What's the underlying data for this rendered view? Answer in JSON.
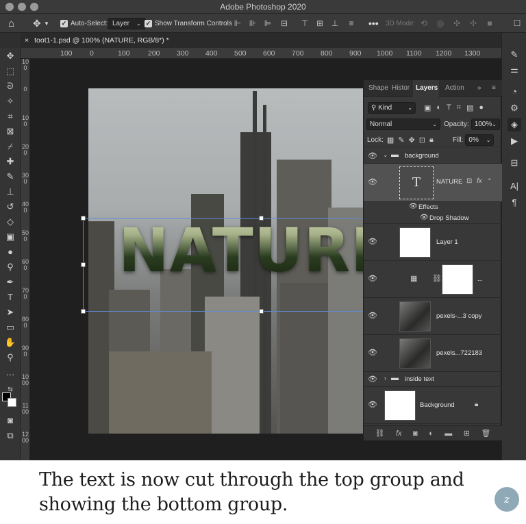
{
  "window": {
    "title": "Adobe Photoshop 2020"
  },
  "options_bar": {
    "auto_select_label": "Auto-Select:",
    "auto_select_value": "Layer",
    "show_transform_label": "Show Transform Controls",
    "three_d_mode_label": "3D Mode:"
  },
  "document": {
    "tab_title": "toot1-1.psd @ 100% (NATURE, RGB/8*) *",
    "close_glyph": "×"
  },
  "ruler_top": [
    "100",
    "0",
    "100",
    "200",
    "300",
    "400",
    "500",
    "600",
    "700",
    "800",
    "900",
    "1000",
    "1100",
    "1200",
    "1300"
  ],
  "ruler_left": [
    "100",
    "0",
    "100",
    "200",
    "300",
    "400",
    "500",
    "600",
    "700",
    "800",
    "900",
    "1000",
    "1100",
    "1200"
  ],
  "canvas": {
    "text_layer_content": "NATURE"
  },
  "layers_panel": {
    "tabs": [
      "Shape",
      "Histor",
      "Layers",
      "Action"
    ],
    "active_tab": "Layers",
    "filter": "Kind",
    "blend_mode": "Normal",
    "opacity_label": "Opacity:",
    "opacity_value": "100%",
    "lock_label": "Lock:",
    "fill_label": "Fill:",
    "fill_value": "0%",
    "layers": [
      {
        "name": "background",
        "kind": "group"
      },
      {
        "name": "NATURE",
        "kind": "text"
      },
      {
        "name": "Effects",
        "kind": "effect-header"
      },
      {
        "name": "Drop Shadow",
        "kind": "effect"
      },
      {
        "name": "Layer 1",
        "kind": "pixel"
      },
      {
        "name": "...",
        "kind": "mask"
      },
      {
        "name": "pexels-...3 copy",
        "kind": "smart"
      },
      {
        "name": "pexels...722183",
        "kind": "smart"
      },
      {
        "name": "inside text",
        "kind": "group"
      },
      {
        "name": "Background",
        "kind": "locked"
      }
    ]
  },
  "caption": {
    "text": "The text is now cut through the top group and showing the bottom group."
  },
  "logo": {
    "text": "z"
  }
}
